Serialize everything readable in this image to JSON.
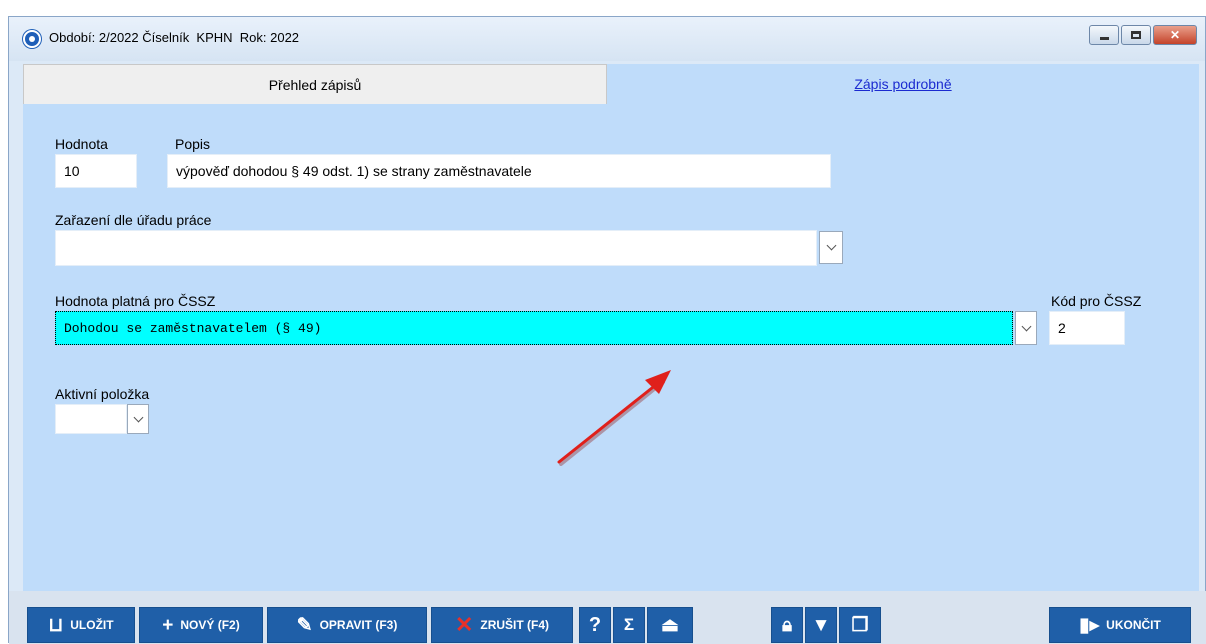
{
  "window": {
    "title": "Období: 2/2022 Číselník  KPHN  Rok: 2022"
  },
  "tabs": {
    "overview": "Přehled zápisů",
    "detail": "Zápis podrobně"
  },
  "form": {
    "hodnota_label": "Hodnota",
    "hodnota_value": "10",
    "popis_label": "Popis",
    "popis_value": "výpověď dohodou § 49 odst. 1) se strany zaměstnavatele",
    "zarazeni_label": "Zařazení dle úřadu práce",
    "zarazeni_value": "",
    "cssz_label": "Hodnota platná pro ČSSZ",
    "cssz_value": "Dohodou se zaměstnavatelem (§ 49)",
    "kod_label": "Kód pro ČSSZ",
    "kod_value": "2",
    "aktivni_label": "Aktivní položka",
    "aktivni_value": ""
  },
  "toolbar": {
    "save": "ULOŽIT",
    "new": "NOVÝ (F2)",
    "edit": "OPRAVIT (F3)",
    "cancel": "ZRUŠIT (F4)",
    "help": "?",
    "sum": "Σ",
    "exit": "UKONČIT"
  },
  "colors": {
    "accent": "#1f5fa8",
    "panel": "#bfdcfa",
    "selection": "#00ffff",
    "arrow": "#e0201b"
  }
}
